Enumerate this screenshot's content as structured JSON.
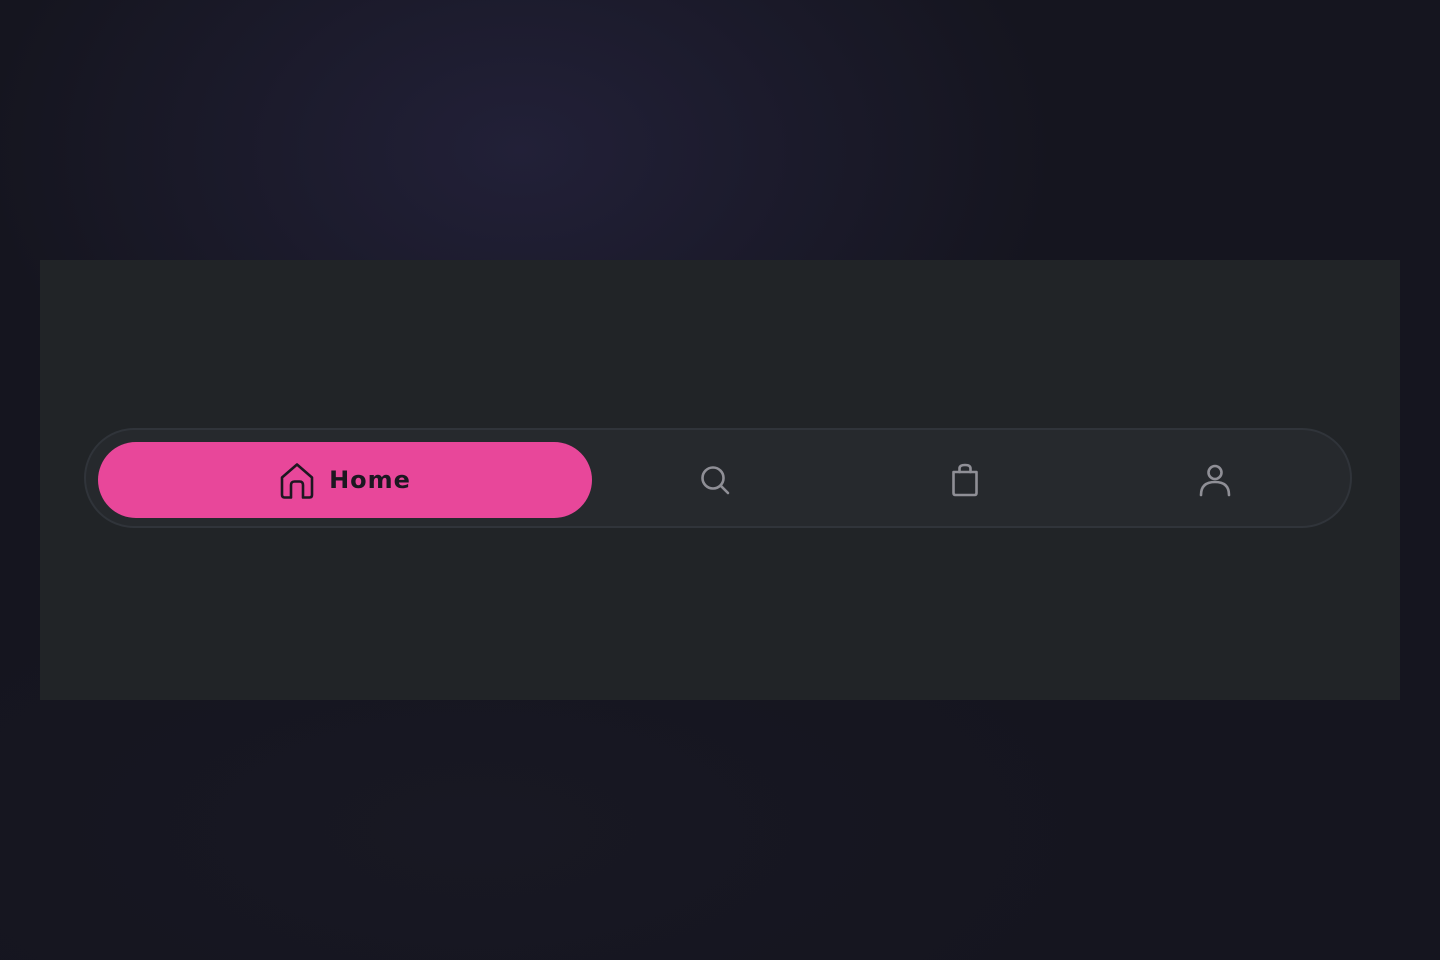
{
  "nav": {
    "active_tab": "home",
    "accent_color": "#e8479a",
    "inactive_icon_color": "#8f8f96",
    "tabs": [
      {
        "id": "home",
        "label": "Home",
        "icon": "home-icon",
        "active": true
      },
      {
        "id": "search",
        "label": "",
        "icon": "search-icon",
        "active": false
      },
      {
        "id": "bag",
        "label": "",
        "icon": "shopping-bag-icon",
        "active": false
      },
      {
        "id": "profile",
        "label": "",
        "icon": "user-icon",
        "active": false
      }
    ]
  }
}
